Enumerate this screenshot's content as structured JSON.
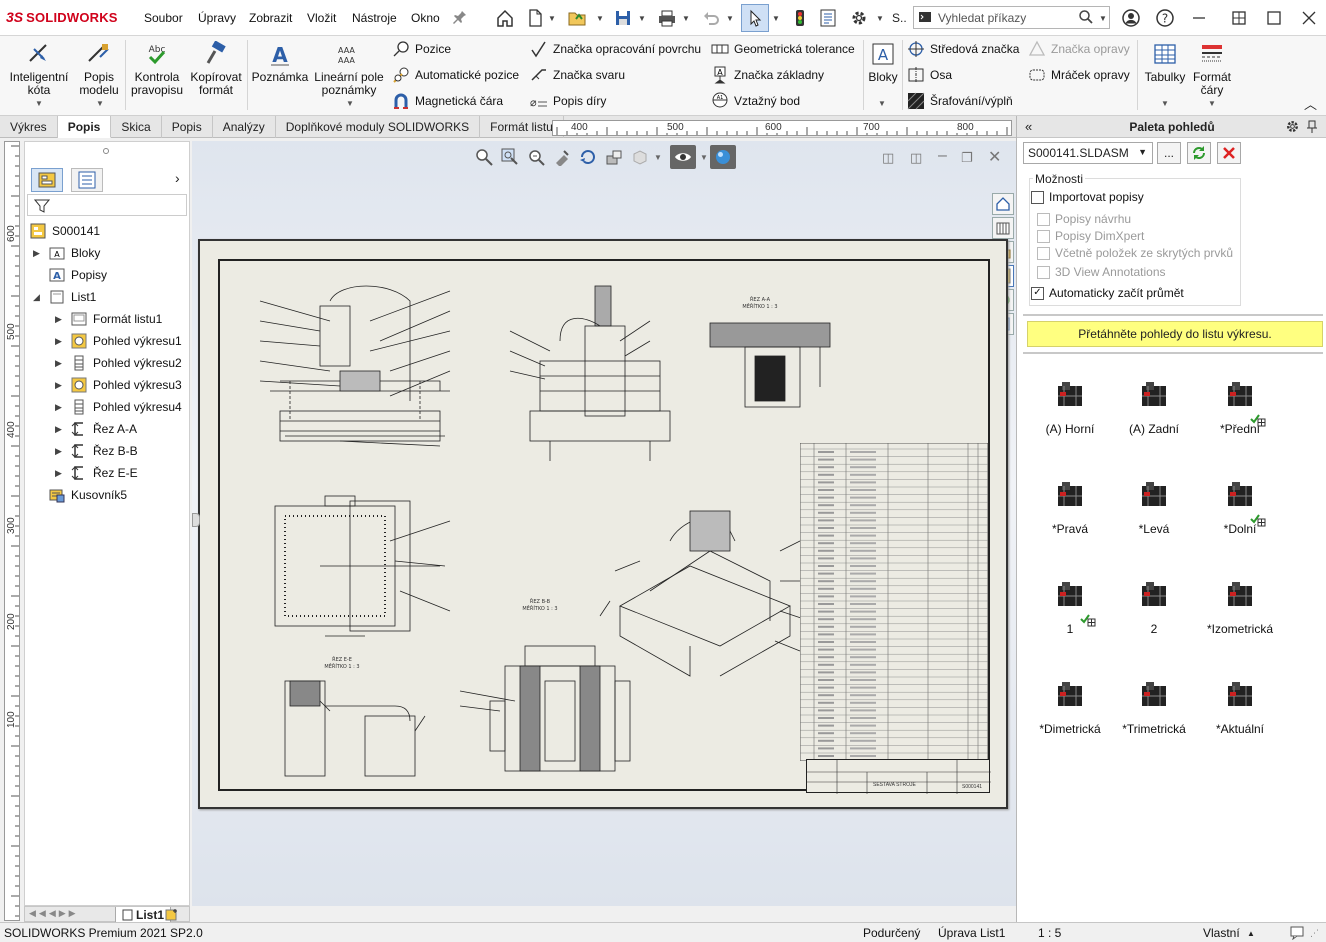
{
  "app": {
    "brand_prefix": "3S",
    "brand": "SOLIDWORKS"
  },
  "menu": [
    "Soubor",
    "Úpravy",
    "Zobrazit",
    "Vložit",
    "Nástroje",
    "Okno"
  ],
  "quick_access": {
    "s_label": "S..",
    "search_placeholder": "Vyhledat příkazy"
  },
  "ribbon": {
    "smart_dim": "Inteligentní\nkóta",
    "model_items": "Popis\nmodelu",
    "spell": "Kontrola\npravopisu",
    "format_painter": "Kopírovat\nformát",
    "note": "Poznámka",
    "linear_pattern": "Lineární pole\npoznámky",
    "balloon": "Pozice",
    "auto_balloon": "Automatické pozice",
    "magnetic_line": "Magnetická čára",
    "surface_finish": "Značka opracování povrchu",
    "weld_symbol": "Značka svaru",
    "hole_callout": "Popis díry",
    "geom_tol": "Geometrická tolerance",
    "datum_feature": "Značka základny",
    "datum_target": "Vztažný bod",
    "blocks": "Bloky",
    "center_mark": "Středová značka",
    "centerline": "Osa",
    "hatch": "Šrafování/výplň",
    "revision_symbol": "Značka opravy",
    "revision_cloud": "Mráček opravy",
    "tables": "Tabulky",
    "line_format": "Formát\nčáry"
  },
  "tabs": [
    "Výkres",
    "Popis",
    "Skica",
    "Popis",
    "Analýzy",
    "Doplňkové moduly SOLIDWORKS",
    "Formát listu"
  ],
  "active_tab": 1,
  "ruler_h": [
    "400",
    "500",
    "600",
    "700",
    "800"
  ],
  "ruler_v": [
    "600",
    "500",
    "400",
    "300",
    "200",
    "100"
  ],
  "tree": {
    "root": "S000141",
    "items": [
      {
        "label": "Bloky",
        "icon": "blocks-folder-icon"
      },
      {
        "label": "Popisy",
        "icon": "annotations-icon"
      },
      {
        "label": "List1",
        "icon": "sheet-icon"
      },
      {
        "label": "Formát listu1",
        "icon": "sheet-format-icon"
      },
      {
        "label": "Pohled výkresu1",
        "icon": "drawing-view-icon"
      },
      {
        "label": "Pohled výkresu2",
        "icon": "drawing-view-icon"
      },
      {
        "label": "Pohled výkresu3",
        "icon": "drawing-view-icon"
      },
      {
        "label": "Pohled výkresu4",
        "icon": "drawing-view-icon"
      },
      {
        "label": "Řez A-A",
        "icon": "section-view-icon"
      },
      {
        "label": "Řez B-B",
        "icon": "section-view-icon"
      },
      {
        "label": "Řez E-E",
        "icon": "section-view-icon"
      },
      {
        "label": "Kusovník5",
        "icon": "bom-icon"
      }
    ]
  },
  "sheet_tab": "List1",
  "drawing": {
    "section_aa": "ŘEZ A-A\nMĚŘÍTKO 1 : 3",
    "section_bb": "ŘEZ B-B\nMĚŘÍTKO 1 : 3",
    "section_ee": "ŘEZ E-E\nMĚŘÍTKO 1 : 3",
    "title_block": "SESTAVA STROJE",
    "drawing_no": "S000141"
  },
  "palette": {
    "title": "Paleta pohledů",
    "model": "S000141.SLDASM",
    "browse": "...",
    "options_title": "Možnosti",
    "import_annotations": "Importovat popisy",
    "design_annotations": "Popisy návrhu",
    "dimxpert": "Popisy DimXpert",
    "hidden_features": "Včetně položek ze skrytých prvků",
    "view_3d": "3D View Annotations",
    "auto_start": "Automaticky začít průmět",
    "drag_hint": "Přetáhněte pohledy do listu výkresu.",
    "views": [
      "(A) Horní",
      "(A) Zadní",
      "*Přední",
      "*Pravá",
      "*Levá",
      "*Dolní",
      "1",
      "2",
      "*Izometrická",
      "*Dimetrická",
      "*Trimetrická",
      "*Aktuální"
    ]
  },
  "status": {
    "product": "SOLIDWORKS Premium 2021 SP2.0",
    "state": "Podurčený",
    "editing": "Úprava List1",
    "scale": "1 : 5",
    "units": "Vlastní"
  }
}
